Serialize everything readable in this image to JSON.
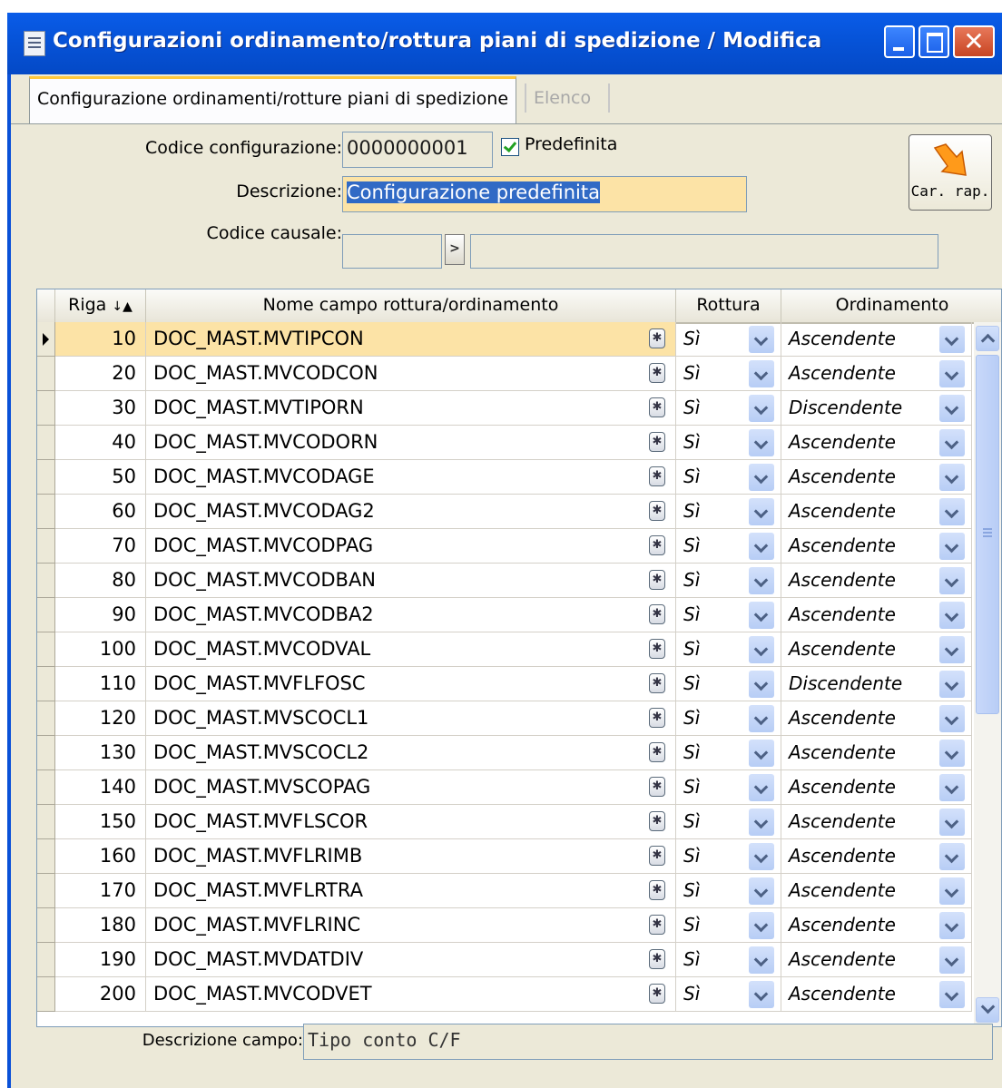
{
  "window": {
    "title": "Configurazioni ordinamento/rottura piani di spedizione / Modifica"
  },
  "tabs": [
    {
      "label": "Configurazione ordinamenti/rotture piani di spedizione",
      "active": true
    },
    {
      "label": "Elenco",
      "active": false
    }
  ],
  "form": {
    "codice_label": "Codice configurazione:",
    "codice_value": "0000000001",
    "predefinita_label": "Predefinita",
    "predefinita_checked": true,
    "descrizione_label": "Descrizione:",
    "descrizione_value": "Configurazione predefinita",
    "causale_label": "Codice causale:",
    "causale_value": "",
    "causale_desc": "",
    "car_rap_label": "Car. rap."
  },
  "grid": {
    "columns": {
      "riga": "Riga",
      "nome": "Nome campo rottura/ordinamento",
      "rottura": "Rottura",
      "ordinamento": "Ordinamento"
    },
    "rows": [
      {
        "riga": "10",
        "nome": "DOC_MAST.MVTIPCON",
        "rottura": "Sì",
        "ordinamento": "Ascendente"
      },
      {
        "riga": "20",
        "nome": "DOC_MAST.MVCODCON",
        "rottura": "Sì",
        "ordinamento": "Ascendente"
      },
      {
        "riga": "30",
        "nome": "DOC_MAST.MVTIPORN",
        "rottura": "Sì",
        "ordinamento": "Discendente"
      },
      {
        "riga": "40",
        "nome": "DOC_MAST.MVCODORN",
        "rottura": "Sì",
        "ordinamento": "Ascendente"
      },
      {
        "riga": "50",
        "nome": "DOC_MAST.MVCODAGE",
        "rottura": "Sì",
        "ordinamento": "Ascendente"
      },
      {
        "riga": "60",
        "nome": "DOC_MAST.MVCODAG2",
        "rottura": "Sì",
        "ordinamento": "Ascendente"
      },
      {
        "riga": "70",
        "nome": "DOC_MAST.MVCODPAG",
        "rottura": "Sì",
        "ordinamento": "Ascendente"
      },
      {
        "riga": "80",
        "nome": "DOC_MAST.MVCODBAN",
        "rottura": "Sì",
        "ordinamento": "Ascendente"
      },
      {
        "riga": "90",
        "nome": "DOC_MAST.MVCODBA2",
        "rottura": "Sì",
        "ordinamento": "Ascendente"
      },
      {
        "riga": "100",
        "nome": "DOC_MAST.MVCODVAL",
        "rottura": "Sì",
        "ordinamento": "Ascendente"
      },
      {
        "riga": "110",
        "nome": "DOC_MAST.MVFLFOSC",
        "rottura": "Sì",
        "ordinamento": "Discendente"
      },
      {
        "riga": "120",
        "nome": "DOC_MAST.MVSCOCL1",
        "rottura": "Sì",
        "ordinamento": "Ascendente"
      },
      {
        "riga": "130",
        "nome": "DOC_MAST.MVSCOCL2",
        "rottura": "Sì",
        "ordinamento": "Ascendente"
      },
      {
        "riga": "140",
        "nome": "DOC_MAST.MVSCOPAG",
        "rottura": "Sì",
        "ordinamento": "Ascendente"
      },
      {
        "riga": "150",
        "nome": "DOC_MAST.MVFLSCOR",
        "rottura": "Sì",
        "ordinamento": "Ascendente"
      },
      {
        "riga": "160",
        "nome": "DOC_MAST.MVFLRIMB",
        "rottura": "Sì",
        "ordinamento": "Ascendente"
      },
      {
        "riga": "170",
        "nome": "DOC_MAST.MVFLRTRA",
        "rottura": "Sì",
        "ordinamento": "Ascendente"
      },
      {
        "riga": "180",
        "nome": "DOC_MAST.MVFLRINC",
        "rottura": "Sì",
        "ordinamento": "Ascendente"
      },
      {
        "riga": "190",
        "nome": "DOC_MAST.MVDATDIV",
        "rottura": "Sì",
        "ordinamento": "Ascendente"
      },
      {
        "riga": "200",
        "nome": "DOC_MAST.MVCODVET",
        "rottura": "Sì",
        "ordinamento": "Ascendente"
      }
    ]
  },
  "footer": {
    "descrizione_campo_label": "Descrizione campo:",
    "descrizione_campo_value": "Tipo conto C/F"
  },
  "icons": {
    "title": "form-icon",
    "zoom": "zoom-icon",
    "car_rap": "load-report-arrow-icon",
    "sort": "sort-ascending-icon"
  },
  "colors": {
    "titlebar": "#0a5ce8",
    "highlight_field": "#fce3a6",
    "selection": "#316ac5",
    "tab_accent": "#ffc83c"
  }
}
